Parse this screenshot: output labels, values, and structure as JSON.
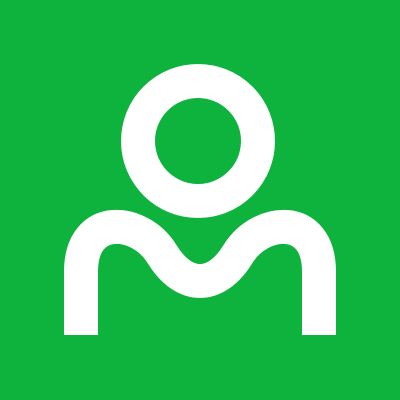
{
  "logo": {
    "icon": "person-icon",
    "background_color": "#0DB33C",
    "foreground_color": "#FFFFFF"
  }
}
